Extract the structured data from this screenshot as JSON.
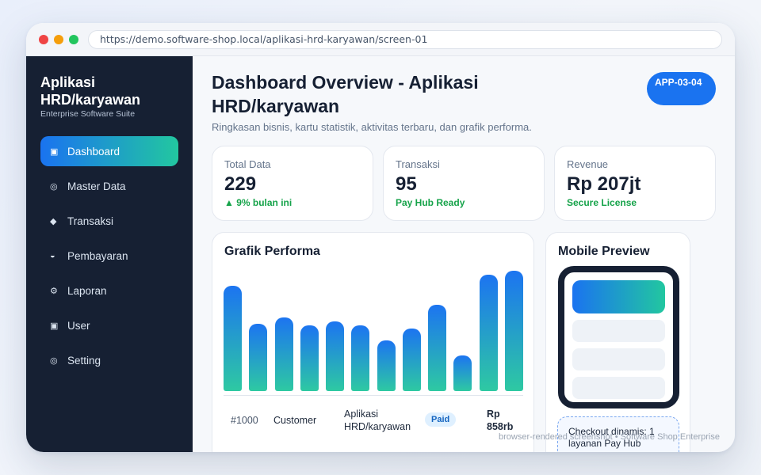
{
  "browser": {
    "url": "https://demo.software-shop.local/aplikasi-hrd-karyawan/screen-01"
  },
  "sidebar": {
    "title": "Aplikasi HRD/karyawan",
    "subtitle": "Enterprise Software Suite",
    "items": [
      {
        "label": "Dashboard",
        "icon": "▣",
        "icon_name": "dashboard-icon",
        "active": true
      },
      {
        "label": "Master Data",
        "icon": "◎",
        "icon_name": "master-data-icon",
        "active": false
      },
      {
        "label": "Transaksi",
        "icon": "◆",
        "icon_name": "transaksi-icon",
        "active": false
      },
      {
        "label": "Pembayaran",
        "icon": "◒",
        "icon_name": "pembayaran-icon",
        "active": false
      },
      {
        "label": "Laporan",
        "icon": "⚙",
        "icon_name": "laporan-icon",
        "active": false
      },
      {
        "label": "User",
        "icon": "▣",
        "icon_name": "user-icon",
        "active": false
      },
      {
        "label": "Setting",
        "icon": "◎",
        "icon_name": "setting-icon",
        "active": false
      }
    ]
  },
  "header": {
    "title": "Dashboard Overview - Aplikasi HRD/karyawan",
    "subtitle": "Ringkasan bisnis, kartu statistik, aktivitas terbaru, dan grafik performa.",
    "badge": "APP-03-04"
  },
  "stats": [
    {
      "label": "Total Data",
      "value": "229",
      "note": "▲ 9% bulan ini"
    },
    {
      "label": "Transaksi",
      "value": "95",
      "note": "Pay Hub Ready"
    },
    {
      "label": "Revenue",
      "value": "Rp 207jt",
      "note": "Secure License"
    }
  ],
  "chart": {
    "title": "Grafik Performa"
  },
  "chart_data": {
    "type": "bar",
    "title": "Grafik Performa",
    "categories": [],
    "values": [
      100,
      64,
      70,
      62,
      66,
      62,
      48,
      59,
      82,
      34,
      110,
      114
    ],
    "ylim": [
      0,
      120
    ],
    "grid": false,
    "colors": [
      "#1c74f1",
      "#2ec9a2"
    ]
  },
  "recent_row": {
    "id": "#1000",
    "customer": "Customer",
    "app": "Aplikasi HRD/karyawan",
    "status": "Paid",
    "amount": "Rp 858rb"
  },
  "mobile": {
    "title": "Mobile Preview",
    "checkout": "Checkout dinamis: 1 layanan Pay Hub"
  },
  "footer": {
    "note": "browser-rendered screenshot • Software Shop Enterprise"
  },
  "colors": {
    "sidebar_bg": "#162033",
    "accent_blue": "#1a73f0",
    "accent_teal": "#22c7a0",
    "positive": "#16a34a"
  }
}
